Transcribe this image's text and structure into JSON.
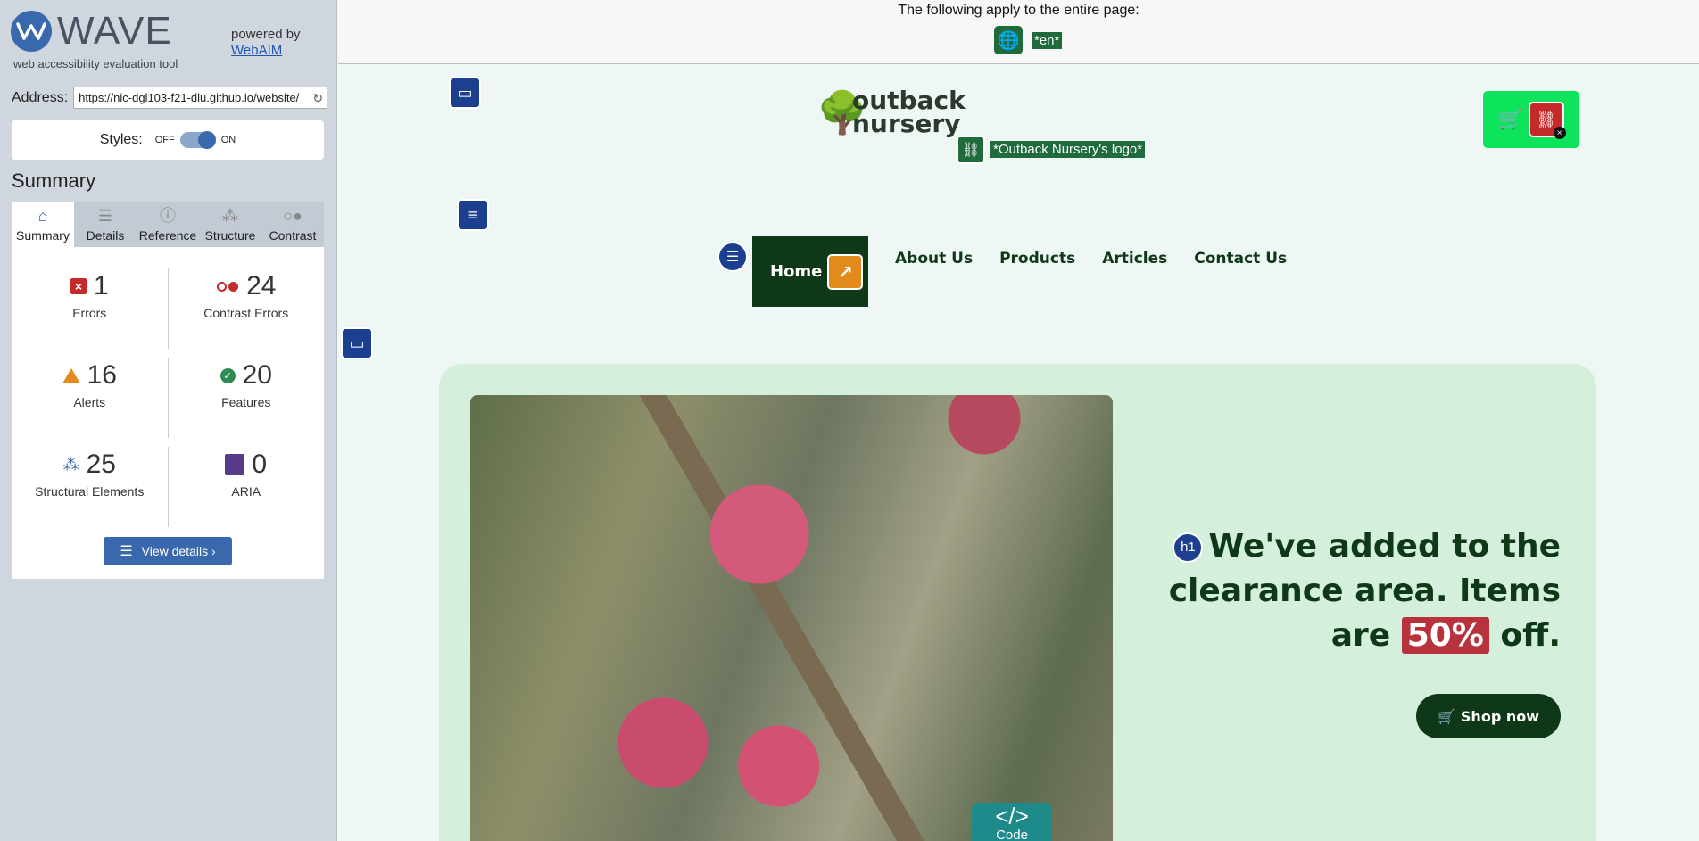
{
  "sidebar": {
    "logo_word": "WAVE",
    "logo_sub": "web accessibility evaluation tool",
    "powered_by": "powered by",
    "powered_link": "WebAIM",
    "address_label": "Address:",
    "address_value": "https://nic-dgl103-f21-dlu.github.io/website/",
    "styles_label": "Styles:",
    "styles_off": "OFF",
    "styles_on": "ON",
    "summary_heading": "Summary",
    "tabs": [
      {
        "label": "Summary",
        "icon": "home-icon"
      },
      {
        "label": "Details",
        "icon": "list-icon"
      },
      {
        "label": "Reference",
        "icon": "info-icon"
      },
      {
        "label": "Structure",
        "icon": "structure-icon"
      },
      {
        "label": "Contrast",
        "icon": "contrast-icon"
      }
    ],
    "stats": {
      "errors": {
        "count": "1",
        "label": "Errors"
      },
      "contrast_errors": {
        "count": "24",
        "label": "Contrast Errors"
      },
      "alerts": {
        "count": "16",
        "label": "Alerts"
      },
      "features": {
        "count": "20",
        "label": "Features"
      },
      "structural": {
        "count": "25",
        "label": "Structural Elements"
      },
      "aria": {
        "count": "0",
        "label": "ARIA"
      }
    },
    "view_details": "View details ›"
  },
  "page": {
    "banner_text": "The following apply to the entire page:",
    "lang_tag": "*en*",
    "logo_line1": "outback",
    "logo_line2": "nursery",
    "logo_alt": "*Outback Nursery's logo*",
    "nav": [
      "Home",
      "About Us",
      "Products",
      "Articles",
      "Contact Us"
    ],
    "hero_title_1": "We've added to the clearance area. Items are",
    "hero_discount": "50%",
    "hero_title_2": "off.",
    "h1_marker": "h1",
    "shop_button": "Shop now",
    "code_label": "Code",
    "code_symbol": "</>"
  },
  "colors": {
    "wave_blue": "#3a68ac",
    "error_red": "#c52a2a",
    "alert_orange": "#e38a1c",
    "feature_green": "#1f6b3c",
    "site_dark_green": "#0f3818",
    "cart_green": "#0ee35c"
  }
}
